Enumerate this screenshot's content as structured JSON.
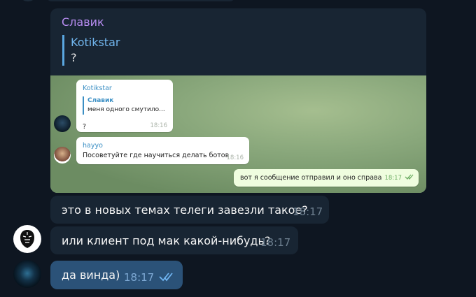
{
  "messages": {
    "big": {
      "sender": "Славик",
      "reply_name": "Kotikstar",
      "reply_text": "?",
      "screenshot": {
        "m1": {
          "name": "Kotikstar",
          "reply_name": "Славик",
          "reply_text": "меня одного смутило...",
          "text": "?",
          "time": "18:16"
        },
        "m2": {
          "name": "hayyo",
          "text": "Посоветуйте где научиться делать ботов",
          "time": "18:16"
        },
        "m3": {
          "text": "вот я сообщение отправил и оно справа",
          "time": "18:17"
        }
      }
    },
    "m2": {
      "text": "это в новых темах телеги завезли такое?",
      "time": "18:17"
    },
    "m3": {
      "text": "или клиент под мак какой-нибудь?",
      "time": "18:17"
    },
    "m4": {
      "text": "да винда)",
      "time": "18:17"
    }
  },
  "icons": {
    "read_check": "double-check-icon"
  },
  "colors": {
    "background": "#0e1621",
    "incoming": "#182533",
    "outgoing": "#2b5278",
    "sender_name": "#b78cf0",
    "reply_accent": "#5aa7e0"
  }
}
